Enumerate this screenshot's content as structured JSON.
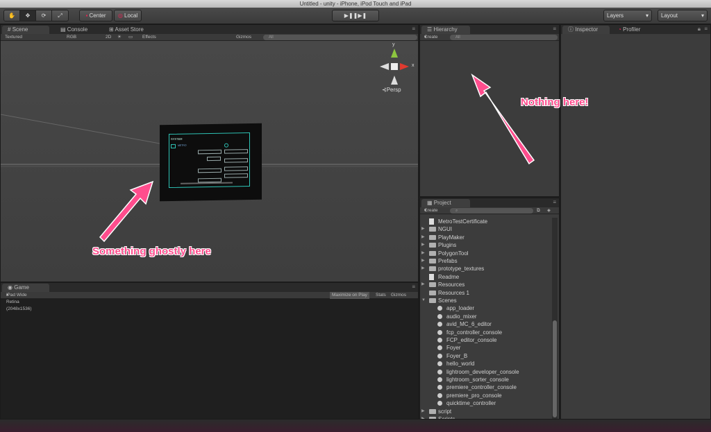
{
  "window": {
    "title": "Untitled - unity - iPhone, iPod Touch and iPad"
  },
  "toolbar": {
    "pivot_label": "Center",
    "space_label": "Local",
    "layers_label": "Layers",
    "layout_label": "Layout"
  },
  "scene_panel": {
    "tabs": [
      "Scene",
      "Console",
      "Asset Store"
    ],
    "shading": "Textured",
    "render_mode": "RGB",
    "mode_2d": "2D",
    "effects": "Effects",
    "gizmos": "Gizmos",
    "search_placeholder": "All",
    "gizmo_labels": {
      "y": "y",
      "x": "x",
      "persp": "Persp"
    },
    "mockup": {
      "title": "SYSTEM",
      "subtitle": "METRO"
    }
  },
  "game_panel": {
    "tab": "Game",
    "resolution": "iPad Wide Retina (2048x1536)",
    "maximize": "Maximize on Play",
    "stats": "Stats",
    "gizmos": "Gizmos"
  },
  "hierarchy_panel": {
    "tab": "Hierarchy",
    "create": "Create",
    "search_placeholder": "All"
  },
  "inspector_panel": {
    "tabs": [
      "Inspector",
      "Profiler"
    ]
  },
  "project_panel": {
    "tab": "Project",
    "create": "Create",
    "items": [
      {
        "label": "MetroTestCertificate",
        "kind": "doc",
        "indent": 0,
        "expand": ""
      },
      {
        "label": "NGUI",
        "kind": "folder",
        "indent": 0,
        "expand": "▶"
      },
      {
        "label": "PlayMaker",
        "kind": "folder",
        "indent": 0,
        "expand": "▶"
      },
      {
        "label": "Plugins",
        "kind": "folder",
        "indent": 0,
        "expand": "▶"
      },
      {
        "label": "PolygonTool",
        "kind": "folder",
        "indent": 0,
        "expand": "▶"
      },
      {
        "label": "Prefabs",
        "kind": "folder",
        "indent": 0,
        "expand": "▶"
      },
      {
        "label": "prototype_textures",
        "kind": "folder",
        "indent": 0,
        "expand": "▶"
      },
      {
        "label": "Readme",
        "kind": "doc",
        "indent": 0,
        "expand": ""
      },
      {
        "label": "Resources",
        "kind": "folder",
        "indent": 0,
        "expand": "▶"
      },
      {
        "label": "Resources 1",
        "kind": "folder",
        "indent": 0,
        "expand": ""
      },
      {
        "label": "Scenes",
        "kind": "folder",
        "indent": 0,
        "expand": "▼"
      },
      {
        "label": "app_loader",
        "kind": "scene",
        "indent": 1,
        "expand": ""
      },
      {
        "label": "audio_mixer",
        "kind": "scene",
        "indent": 1,
        "expand": ""
      },
      {
        "label": "avid_MC_6_editor",
        "kind": "scene",
        "indent": 1,
        "expand": ""
      },
      {
        "label": "fcp_controller_console",
        "kind": "scene",
        "indent": 1,
        "expand": ""
      },
      {
        "label": "FCP_editor_console",
        "kind": "scene",
        "indent": 1,
        "expand": ""
      },
      {
        "label": "Foyer",
        "kind": "scene",
        "indent": 1,
        "expand": ""
      },
      {
        "label": "Foyer_B",
        "kind": "scene",
        "indent": 1,
        "expand": ""
      },
      {
        "label": "hello_world",
        "kind": "scene",
        "indent": 1,
        "expand": ""
      },
      {
        "label": "lightroom_developer_console",
        "kind": "scene",
        "indent": 1,
        "expand": ""
      },
      {
        "label": "lightroom_sorter_console",
        "kind": "scene",
        "indent": 1,
        "expand": ""
      },
      {
        "label": "premiere_controller_console",
        "kind": "scene",
        "indent": 1,
        "expand": ""
      },
      {
        "label": "premiere_pro_console",
        "kind": "scene",
        "indent": 1,
        "expand": ""
      },
      {
        "label": "quicktime_controller",
        "kind": "scene",
        "indent": 1,
        "expand": ""
      },
      {
        "label": "script",
        "kind": "folder",
        "indent": 0,
        "expand": "▶"
      },
      {
        "label": "Scripts",
        "kind": "folder",
        "indent": 0,
        "expand": "▶"
      }
    ]
  },
  "annotations": {
    "scene_note": "Something ghostly here",
    "hierarchy_note": "Nothing here!"
  },
  "colors": {
    "annotation": "#ff4d8d",
    "gizmo_y": "#8dc63f",
    "gizmo_x": "#e03a2f",
    "mockup_border": "#2ec4b6"
  }
}
